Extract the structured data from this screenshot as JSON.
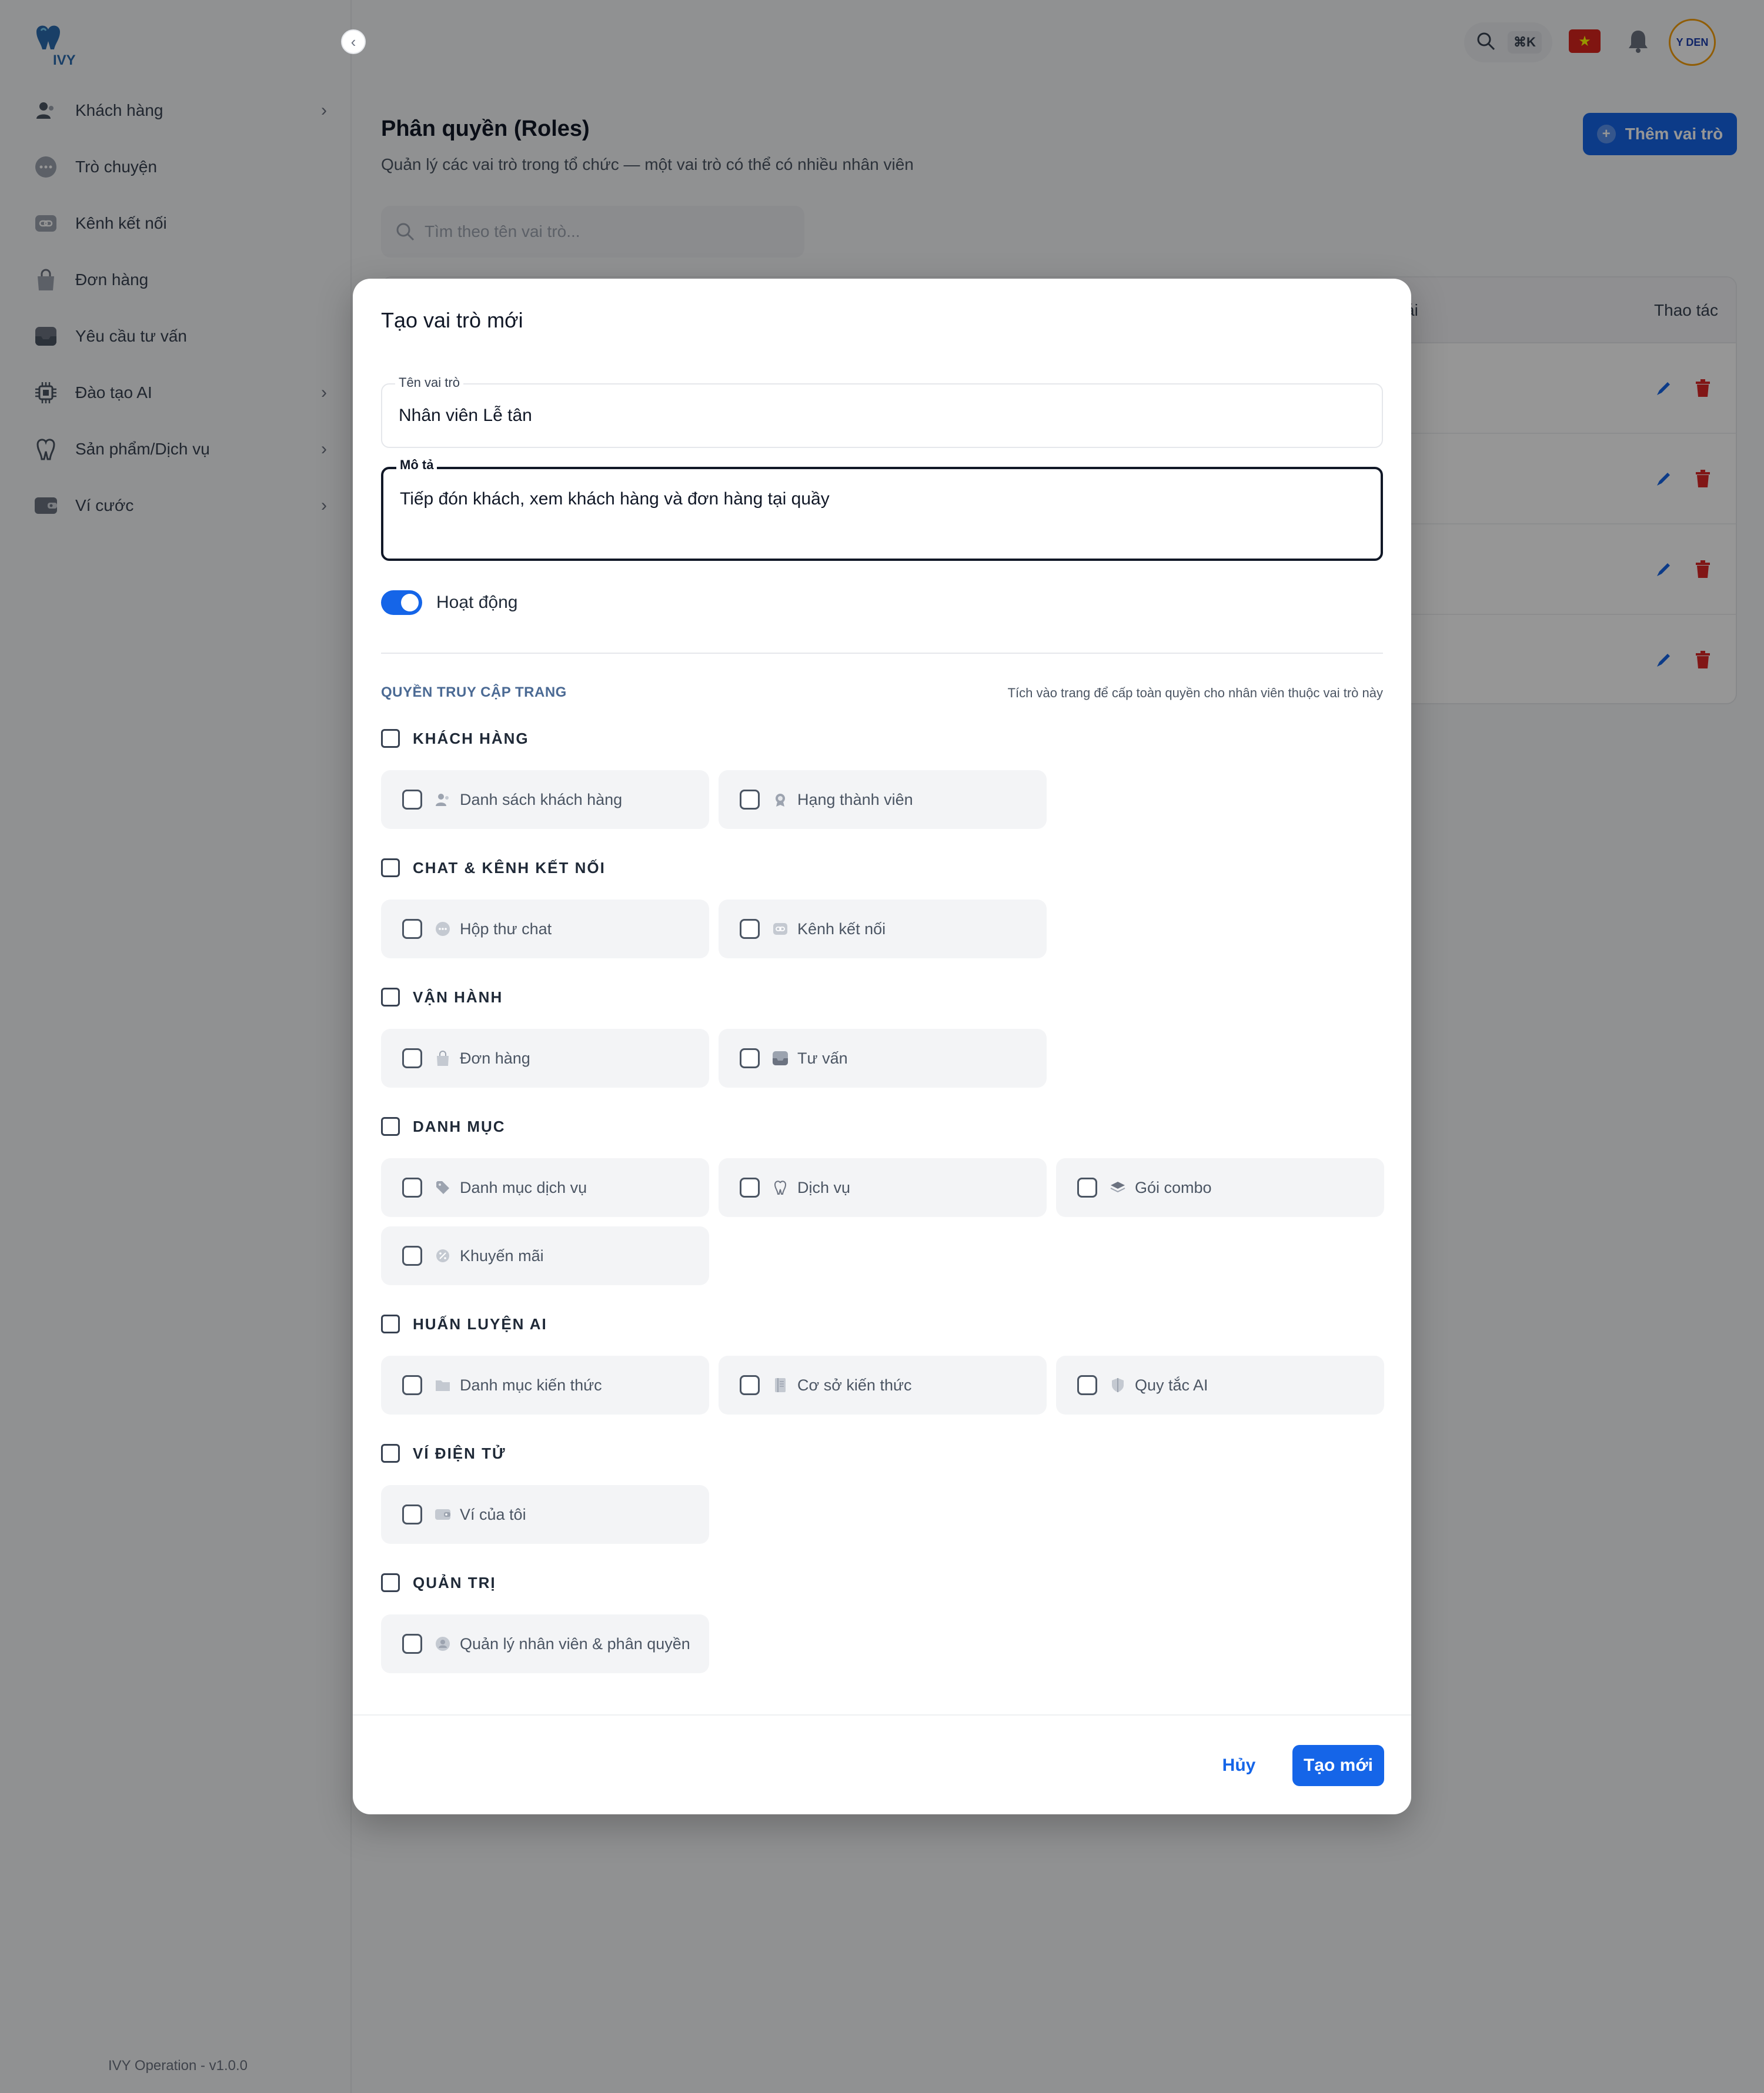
{
  "sidebar": {
    "items": [
      {
        "label": "Khách hàng",
        "icon": "users-icon",
        "has_children": true
      },
      {
        "label": "Trò chuyện",
        "icon": "chat-icon",
        "has_children": false
      },
      {
        "label": "Kênh kết nối",
        "icon": "link-icon",
        "has_children": false
      },
      {
        "label": "Đơn hàng",
        "icon": "shopping-bag-icon",
        "has_children": false
      },
      {
        "label": "Yêu cầu tư vấn",
        "icon": "inbox-icon",
        "has_children": false
      },
      {
        "label": "Đào tạo AI",
        "icon": "cpu-icon",
        "has_children": true
      },
      {
        "label": "Sản phẩm/Dịch vụ",
        "icon": "tooth-icon",
        "has_children": true
      },
      {
        "label": "Ví cước",
        "icon": "wallet-icon",
        "has_children": true
      }
    ],
    "version": "IVY Operation - v1.0.0"
  },
  "topbar": {
    "shortcut": "⌘K",
    "avatar_text": "Y DEN"
  },
  "page": {
    "title": "Phân quyền (Roles)",
    "subtitle": "Quản lý các vai trò trong tổ chức — một vai trò có thể có nhiều nhân viên",
    "add_button": "Thêm vai trò",
    "search_placeholder": "Tìm theo tên vai trò...",
    "table": {
      "status_header_fragment": "ái",
      "actions_header": "Thao tác",
      "row_count": 4
    }
  },
  "modal": {
    "title": "Tạo vai trò mới",
    "name_label": "Tên vai trò",
    "name_value": "Nhân viên Lễ tân",
    "desc_label": "Mô tả",
    "desc_value": "Tiếp đón khách, xem khách hàng và đơn hàng tại quầy",
    "active_label": "Hoạt động",
    "active": true,
    "permissions_heading": "QUYỀN TRUY CẬP TRANG",
    "permissions_hint": "Tích vào trang để cấp toàn quyền cho nhân viên thuộc vai trò này",
    "groups": [
      {
        "title": "KHÁCH HÀNG",
        "pages": [
          {
            "label": "Danh sách khách hàng",
            "icon": "users-icon"
          },
          {
            "label": "Hạng thành viên",
            "icon": "badge-icon"
          }
        ]
      },
      {
        "title": "CHAT & KÊNH KẾT NỐI",
        "pages": [
          {
            "label": "Hộp thư chat",
            "icon": "chat-icon"
          },
          {
            "label": "Kênh kết nối",
            "icon": "link-icon"
          }
        ]
      },
      {
        "title": "VẬN HÀNH",
        "pages": [
          {
            "label": "Đơn hàng",
            "icon": "shopping-bag-icon"
          },
          {
            "label": "Tư vấn",
            "icon": "inbox-icon"
          }
        ]
      },
      {
        "title": "DANH MỤC",
        "pages": [
          {
            "label": "Danh mục dịch vụ",
            "icon": "tag-icon"
          },
          {
            "label": "Dịch vụ",
            "icon": "tooth-icon"
          },
          {
            "label": "Gói combo",
            "icon": "layers-icon"
          },
          {
            "label": "Khuyến mãi",
            "icon": "percent-icon"
          }
        ]
      },
      {
        "title": "HUẤN LUYỆN AI",
        "pages": [
          {
            "label": "Danh mục kiến thức",
            "icon": "folder-icon"
          },
          {
            "label": "Cơ sở kiến thức",
            "icon": "book-icon"
          },
          {
            "label": "Quy tắc AI",
            "icon": "shield-icon"
          }
        ]
      },
      {
        "title": "VÍ ĐIỆN TỬ",
        "pages": [
          {
            "label": "Ví của tôi",
            "icon": "wallet-icon"
          }
        ]
      },
      {
        "title": "QUẢN TRỊ",
        "pages": [
          {
            "label": "Quản lý nhân viên & phân quyền",
            "icon": "user-shield-icon"
          }
        ]
      }
    ],
    "cancel_button": "Hủy",
    "create_button": "Tạo mới"
  },
  "colors": {
    "primary": "#1565e8",
    "danger": "#dc2626",
    "overlay": "rgba(0,0,0,0.41)"
  }
}
